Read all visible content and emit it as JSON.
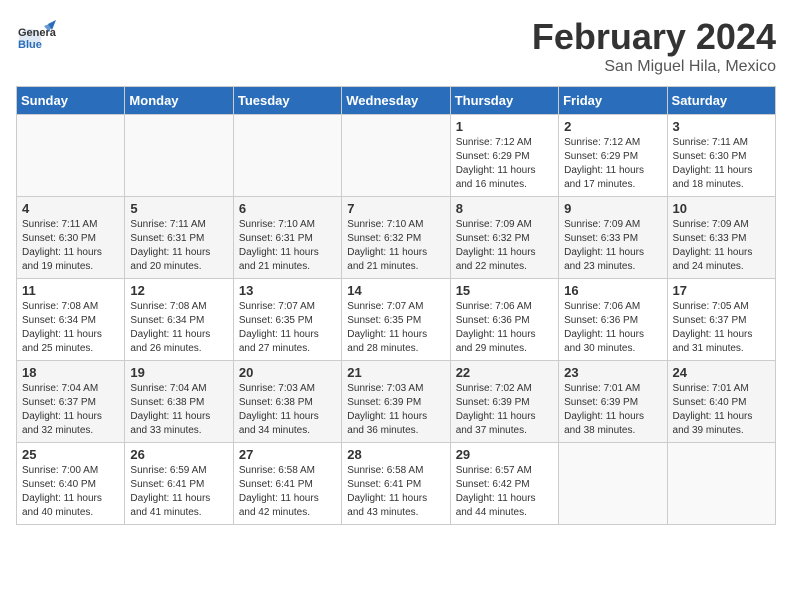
{
  "logo": {
    "general": "General",
    "blue": "Blue"
  },
  "title": "February 2024",
  "location": "San Miguel Hila, Mexico",
  "days_of_week": [
    "Sunday",
    "Monday",
    "Tuesday",
    "Wednesday",
    "Thursday",
    "Friday",
    "Saturday"
  ],
  "weeks": [
    [
      {
        "day": "",
        "info": ""
      },
      {
        "day": "",
        "info": ""
      },
      {
        "day": "",
        "info": ""
      },
      {
        "day": "",
        "info": ""
      },
      {
        "day": "1",
        "info": "Sunrise: 7:12 AM\nSunset: 6:29 PM\nDaylight: 11 hours and 16 minutes."
      },
      {
        "day": "2",
        "info": "Sunrise: 7:12 AM\nSunset: 6:29 PM\nDaylight: 11 hours and 17 minutes."
      },
      {
        "day": "3",
        "info": "Sunrise: 7:11 AM\nSunset: 6:30 PM\nDaylight: 11 hours and 18 minutes."
      }
    ],
    [
      {
        "day": "4",
        "info": "Sunrise: 7:11 AM\nSunset: 6:30 PM\nDaylight: 11 hours and 19 minutes."
      },
      {
        "day": "5",
        "info": "Sunrise: 7:11 AM\nSunset: 6:31 PM\nDaylight: 11 hours and 20 minutes."
      },
      {
        "day": "6",
        "info": "Sunrise: 7:10 AM\nSunset: 6:31 PM\nDaylight: 11 hours and 21 minutes."
      },
      {
        "day": "7",
        "info": "Sunrise: 7:10 AM\nSunset: 6:32 PM\nDaylight: 11 hours and 21 minutes."
      },
      {
        "day": "8",
        "info": "Sunrise: 7:09 AM\nSunset: 6:32 PM\nDaylight: 11 hours and 22 minutes."
      },
      {
        "day": "9",
        "info": "Sunrise: 7:09 AM\nSunset: 6:33 PM\nDaylight: 11 hours and 23 minutes."
      },
      {
        "day": "10",
        "info": "Sunrise: 7:09 AM\nSunset: 6:33 PM\nDaylight: 11 hours and 24 minutes."
      }
    ],
    [
      {
        "day": "11",
        "info": "Sunrise: 7:08 AM\nSunset: 6:34 PM\nDaylight: 11 hours and 25 minutes."
      },
      {
        "day": "12",
        "info": "Sunrise: 7:08 AM\nSunset: 6:34 PM\nDaylight: 11 hours and 26 minutes."
      },
      {
        "day": "13",
        "info": "Sunrise: 7:07 AM\nSunset: 6:35 PM\nDaylight: 11 hours and 27 minutes."
      },
      {
        "day": "14",
        "info": "Sunrise: 7:07 AM\nSunset: 6:35 PM\nDaylight: 11 hours and 28 minutes."
      },
      {
        "day": "15",
        "info": "Sunrise: 7:06 AM\nSunset: 6:36 PM\nDaylight: 11 hours and 29 minutes."
      },
      {
        "day": "16",
        "info": "Sunrise: 7:06 AM\nSunset: 6:36 PM\nDaylight: 11 hours and 30 minutes."
      },
      {
        "day": "17",
        "info": "Sunrise: 7:05 AM\nSunset: 6:37 PM\nDaylight: 11 hours and 31 minutes."
      }
    ],
    [
      {
        "day": "18",
        "info": "Sunrise: 7:04 AM\nSunset: 6:37 PM\nDaylight: 11 hours and 32 minutes."
      },
      {
        "day": "19",
        "info": "Sunrise: 7:04 AM\nSunset: 6:38 PM\nDaylight: 11 hours and 33 minutes."
      },
      {
        "day": "20",
        "info": "Sunrise: 7:03 AM\nSunset: 6:38 PM\nDaylight: 11 hours and 34 minutes."
      },
      {
        "day": "21",
        "info": "Sunrise: 7:03 AM\nSunset: 6:39 PM\nDaylight: 11 hours and 36 minutes."
      },
      {
        "day": "22",
        "info": "Sunrise: 7:02 AM\nSunset: 6:39 PM\nDaylight: 11 hours and 37 minutes."
      },
      {
        "day": "23",
        "info": "Sunrise: 7:01 AM\nSunset: 6:39 PM\nDaylight: 11 hours and 38 minutes."
      },
      {
        "day": "24",
        "info": "Sunrise: 7:01 AM\nSunset: 6:40 PM\nDaylight: 11 hours and 39 minutes."
      }
    ],
    [
      {
        "day": "25",
        "info": "Sunrise: 7:00 AM\nSunset: 6:40 PM\nDaylight: 11 hours and 40 minutes."
      },
      {
        "day": "26",
        "info": "Sunrise: 6:59 AM\nSunset: 6:41 PM\nDaylight: 11 hours and 41 minutes."
      },
      {
        "day": "27",
        "info": "Sunrise: 6:58 AM\nSunset: 6:41 PM\nDaylight: 11 hours and 42 minutes."
      },
      {
        "day": "28",
        "info": "Sunrise: 6:58 AM\nSunset: 6:41 PM\nDaylight: 11 hours and 43 minutes."
      },
      {
        "day": "29",
        "info": "Sunrise: 6:57 AM\nSunset: 6:42 PM\nDaylight: 11 hours and 44 minutes."
      },
      {
        "day": "",
        "info": ""
      },
      {
        "day": "",
        "info": ""
      }
    ]
  ]
}
